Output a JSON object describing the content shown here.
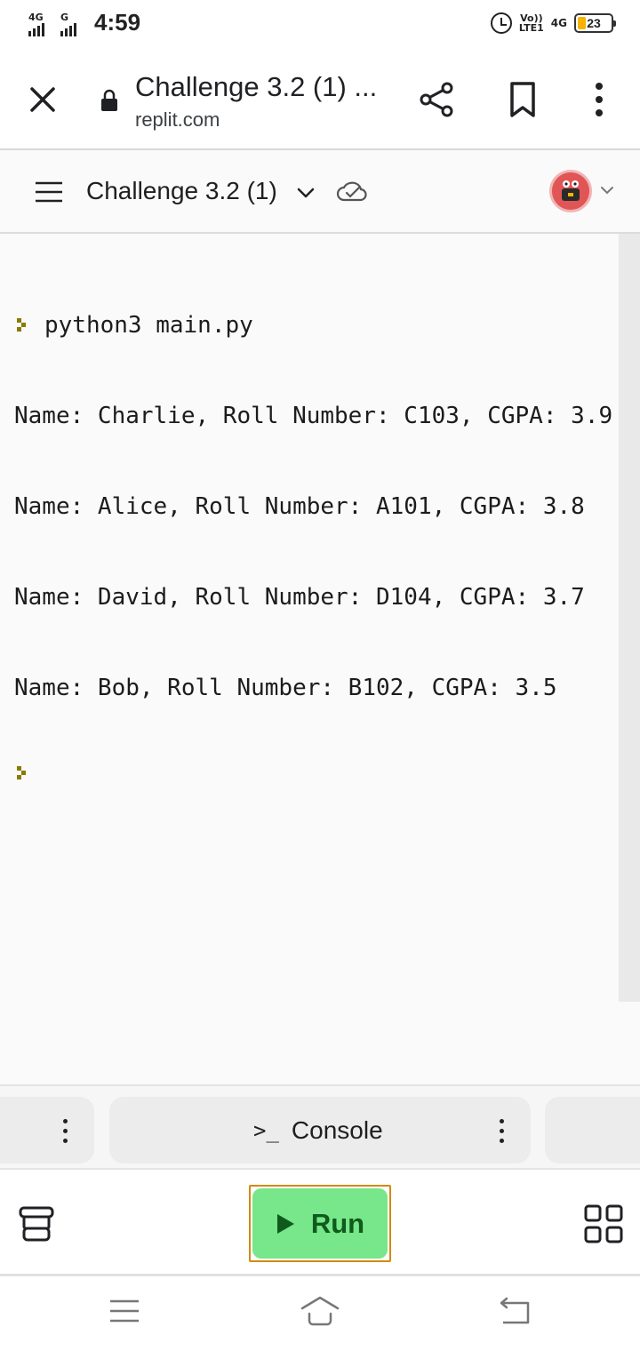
{
  "status_bar": {
    "network1": "4G",
    "network2": "G",
    "time": "4:59",
    "volte_top": "Vo))",
    "volte_bottom": "LTE1",
    "network_right": "4G",
    "battery": "23"
  },
  "browser": {
    "page_title": "Challenge 3.2 (1) ...",
    "url": "replit.com"
  },
  "header": {
    "repl_name": "Challenge 3.2 (1)"
  },
  "console": {
    "command": "python3 main.py",
    "output_lines": [
      "Name: Charlie, Roll Number: C103, CGPA: 3.9",
      "Name: Alice, Roll Number: A101, CGPA: 3.8",
      "Name: David, Roll Number: D104, CGPA: 3.7",
      "Name: Bob, Roll Number: B102, CGPA: 3.5"
    ]
  },
  "tabs": {
    "console_label": "Console",
    "console_glyph": ">_"
  },
  "toolbar": {
    "run_label": "Run"
  },
  "colors": {
    "run_green": "#78e68a",
    "run_text": "#0f5b1c",
    "run_focus": "#d48a13",
    "prompt_olive": "#8a7a00",
    "avatar_red": "#e05656"
  }
}
